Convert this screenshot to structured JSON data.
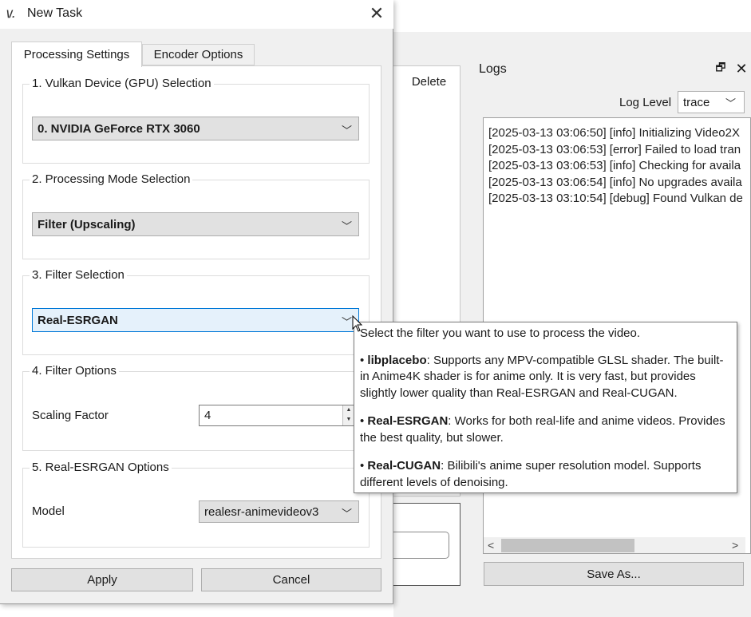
{
  "background": {
    "delete_label": "Delete",
    "logs": {
      "title": "Logs",
      "log_level_label": "Log Level",
      "log_level_value": "trace",
      "lines": [
        "[2025-03-13 03:06:50] [info] Initializing Video2X",
        "[2025-03-13 03:06:53] [error] Failed to load tran",
        "[2025-03-13 03:06:53] [info] Checking for availa",
        "[2025-03-13 03:06:54] [info] No upgrades availa",
        "[2025-03-13 03:10:54] [debug] Found Vulkan de"
      ],
      "save_as_label": "Save As..."
    }
  },
  "dialog": {
    "title": "New Task",
    "tabs": [
      "Processing Settings",
      "Encoder Options"
    ],
    "groups": {
      "gpu": {
        "label": "1. Vulkan Device (GPU) Selection",
        "value": "0. NVIDIA GeForce RTX 3060"
      },
      "mode": {
        "label": "2. Processing Mode Selection",
        "value": "Filter (Upscaling)"
      },
      "filter": {
        "label": "3. Filter Selection",
        "value": "Real-ESRGAN"
      },
      "filter_options": {
        "label": "4. Filter Options",
        "scaling_label": "Scaling Factor",
        "scaling_value": "4"
      },
      "esrgan": {
        "label": "5. Real-ESRGAN Options",
        "model_label": "Model",
        "model_value": "realesr-animevideov3"
      }
    },
    "apply_label": "Apply",
    "cancel_label": "Cancel"
  },
  "tooltip": {
    "intro": "Select the filter you want to use to process the video.",
    "items": [
      {
        "name": "libplacebo",
        "text": ": Supports any MPV-compatible GLSL shader. The built-in Anime4K shader is for anime only. It is very fast, but provides slightly lower quality than Real-ESRGAN and Real-CUGAN."
      },
      {
        "name": "Real-ESRGAN",
        "text": ": Works for both real-life and anime videos. Provides the best quality, but slower."
      },
      {
        "name": "Real-CUGAN",
        "text": ": Bilibili's anime super resolution model. Supports different levels of denoising."
      }
    ]
  },
  "icons": {
    "app": "video2x-app-icon",
    "close": "close-icon",
    "float": "float-window-icon",
    "dropdown": "chevron-down-icon"
  }
}
